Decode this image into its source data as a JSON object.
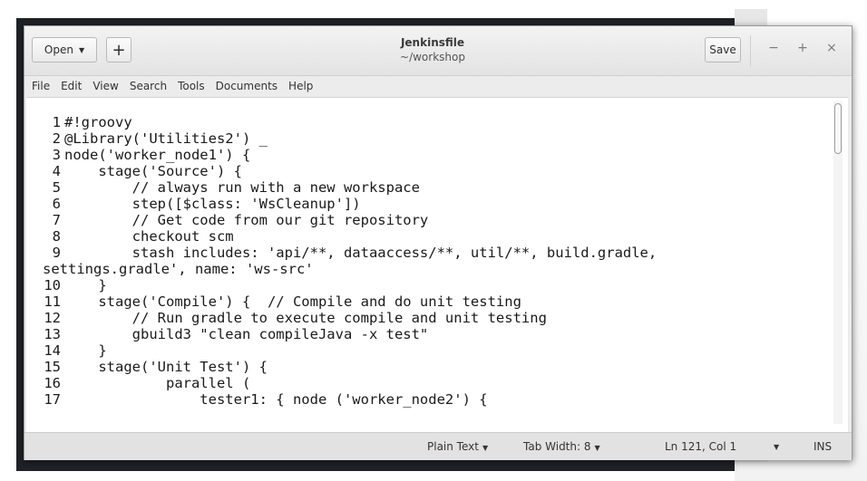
{
  "window": {
    "title": "Jenkinsfile",
    "subtitle": "~/workshop",
    "open_label": "Open",
    "new_label": "+",
    "save_label": "Save",
    "minimize": "−",
    "maximize": "+",
    "close": "×"
  },
  "menu": [
    "File",
    "Edit",
    "View",
    "Search",
    "Tools",
    "Documents",
    "Help"
  ],
  "code_lines": [
    {
      "n": "1",
      "text": "#!groovy"
    },
    {
      "n": "2",
      "text": "@Library('Utilities2') _"
    },
    {
      "n": "3",
      "text": "node('worker_node1') {"
    },
    {
      "n": "4",
      "text": "    stage('Source') {"
    },
    {
      "n": "5",
      "text": "        // always run with a new workspace"
    },
    {
      "n": "6",
      "text": "        step([$class: 'WsCleanup'])"
    },
    {
      "n": "7",
      "text": "        // Get code from our git repository"
    },
    {
      "n": "8",
      "text": "        checkout scm"
    },
    {
      "n": "9",
      "text": "        stash includes: 'api/**, dataaccess/**, util/**, build.gradle,"
    },
    {
      "n": "",
      "text": "settings.gradle', name: 'ws-src'"
    },
    {
      "n": "10",
      "text": "    }"
    },
    {
      "n": "11",
      "text": "    stage('Compile') {  // Compile and do unit testing"
    },
    {
      "n": "12",
      "text": "        // Run gradle to execute compile and unit testing"
    },
    {
      "n": "13",
      "text": "        gbuild3 \"clean compileJava -x test\""
    },
    {
      "n": "14",
      "text": "    }"
    },
    {
      "n": "15",
      "text": "    stage('Unit Test') {"
    },
    {
      "n": "16",
      "text": "            parallel ("
    },
    {
      "n": "17",
      "text": "                tester1: { node ('worker_node2') {"
    }
  ],
  "status": {
    "language": "Plain Text",
    "tab_width": "Tab Width: 8",
    "position": "Ln 121, Col 1",
    "mode": "INS"
  }
}
